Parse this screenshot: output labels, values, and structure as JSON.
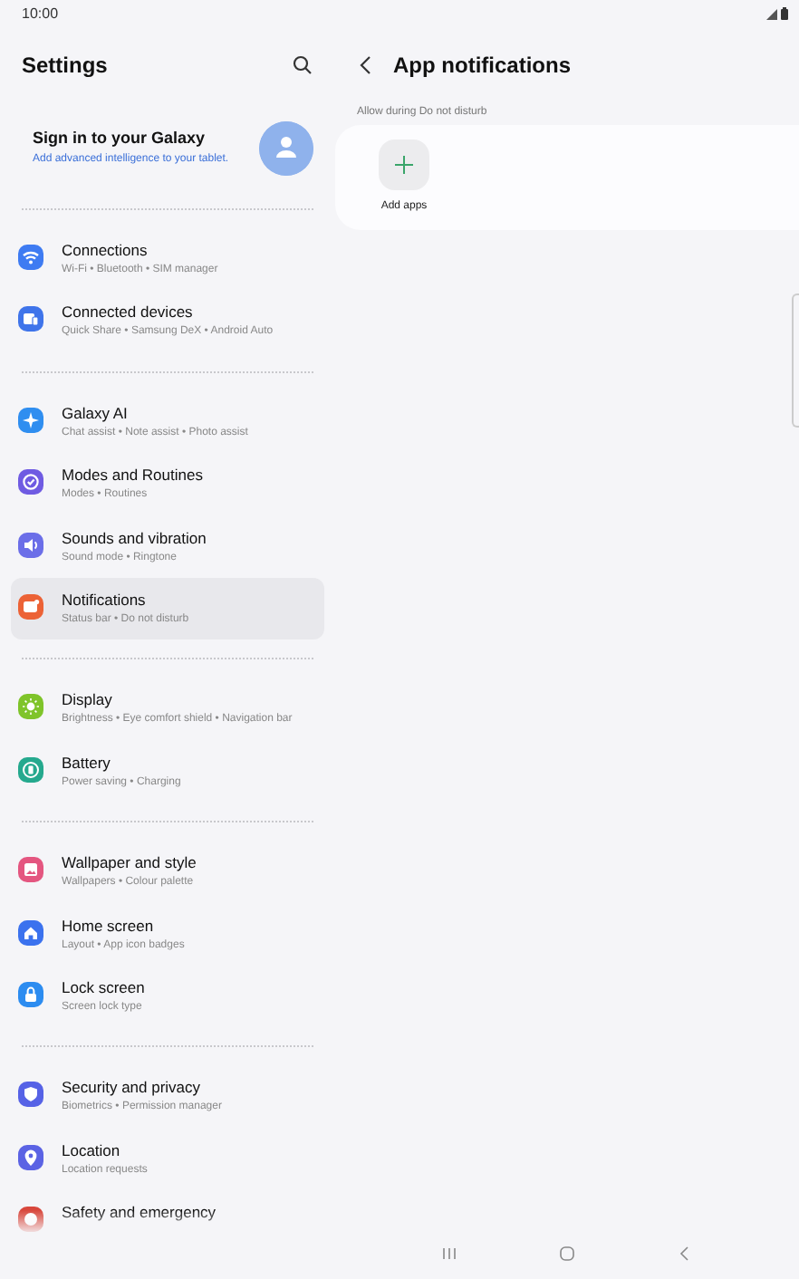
{
  "status_bar": {
    "time": "10:00"
  },
  "settings": {
    "title": "Settings",
    "account": {
      "title": "Sign in to your Galaxy",
      "subtitle": "Add advanced intelligence to your tablet."
    },
    "groups": [
      {
        "items": [
          {
            "title": "Connections",
            "subtitle": "Wi-Fi  •  Bluetooth  •  SIM manager",
            "color": "#3e7bf2",
            "selected": false
          },
          {
            "title": "Connected devices",
            "subtitle": "Quick Share  •  Samsung DeX  •  Android Auto",
            "color": "#3f74ea",
            "selected": false
          }
        ]
      },
      {
        "items": [
          {
            "title": "Galaxy AI",
            "subtitle": "Chat assist  •  Note assist  •  Photo assist",
            "color": "#2f8ef0",
            "selected": false
          },
          {
            "title": "Modes and Routines",
            "subtitle": "Modes  •  Routines",
            "color": "#6f5be2",
            "selected": false
          },
          {
            "title": "Sounds and vibration",
            "subtitle": "Sound mode  •  Ringtone",
            "color": "#6b6ee8",
            "selected": false
          },
          {
            "title": "Notifications",
            "subtitle": "Status bar  •  Do not disturb",
            "color": "#ec6236",
            "selected": true
          }
        ]
      },
      {
        "items": [
          {
            "title": "Display",
            "subtitle": "Brightness  •  Eye comfort shield  •  Navigation bar",
            "color": "#7fc42a",
            "selected": false
          },
          {
            "title": "Battery",
            "subtitle": "Power saving  •  Charging",
            "color": "#25a98e",
            "selected": false
          }
        ]
      },
      {
        "items": [
          {
            "title": "Wallpaper and style",
            "subtitle": "Wallpapers  •  Colour palette",
            "color": "#e45680",
            "selected": false
          },
          {
            "title": "Home screen",
            "subtitle": "Layout  •  App icon badges",
            "color": "#3b72ee",
            "selected": false
          },
          {
            "title": "Lock screen",
            "subtitle": "Screen lock type",
            "color": "#2c8cf0",
            "selected": false
          }
        ]
      },
      {
        "items": [
          {
            "title": "Security and privacy",
            "subtitle": "Biometrics  •  Permission manager",
            "color": "#5662e6",
            "selected": false
          },
          {
            "title": "Location",
            "subtitle": "Location requests",
            "color": "#5b63e4",
            "selected": false
          },
          {
            "title": "Safety and emergency",
            "color": "#d8473c",
            "selected": false
          }
        ]
      }
    ]
  },
  "detail": {
    "title": "App notifications",
    "section": "Allow during Do not disturb",
    "add_label": "Add apps"
  }
}
